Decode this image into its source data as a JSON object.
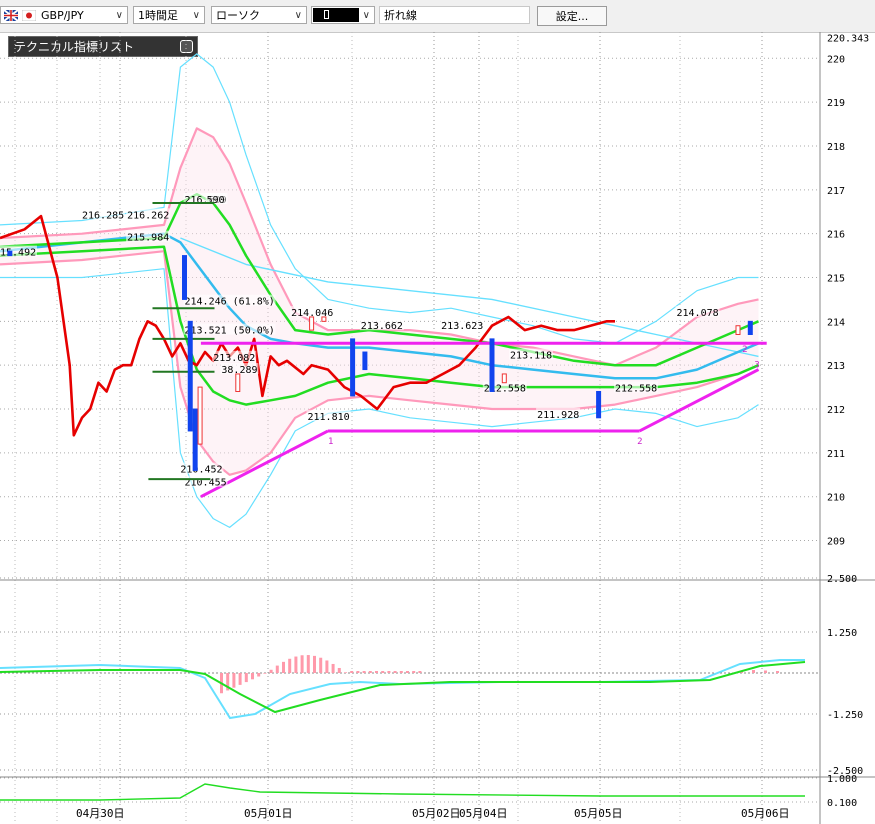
{
  "toolbar": {
    "symbol": "GBP/JPY",
    "timeframe": "1時間足",
    "chart_type": "ローソク",
    "line_type": "折れ線",
    "settings_label": "設定..."
  },
  "indicator_list": {
    "title": "テクニカル指標リスト"
  },
  "colors": {
    "close_line": "#e60000",
    "bollinger_outer": "#66e0ff",
    "bollinger_inner": "#ff99bb",
    "ma_green": "#22dd22",
    "ma_blue": "#33bbee",
    "trendline": "#ee22ee",
    "candle_up": "#ee3333",
    "candle_down": "#1144ee"
  },
  "chart_data": {
    "type": "line",
    "price_axis": {
      "ticks": [
        "220.343",
        "220",
        "219",
        "218",
        "217",
        "216",
        "215",
        "214",
        "213",
        "212",
        "211",
        "210",
        "209"
      ],
      "current_price": "220.343",
      "ylim": [
        208.1,
        220.6
      ]
    },
    "macd_axis": {
      "ticks": [
        "2.500",
        "1.250",
        "-1.250",
        "-2.500"
      ]
    },
    "osc_axis": {
      "ticks": [
        "1.000",
        "0.100"
      ]
    },
    "date_labels": [
      "04月30日",
      "05月01日",
      "05月02日",
      "05月04日",
      "05月05日",
      "05月06日"
    ],
    "annotations": [
      {
        "text": "216.285",
        "x": 0.1,
        "y": 216.35
      },
      {
        "text": "216.262",
        "x": 0.155,
        "y": 216.35
      },
      {
        "text": "215.984",
        "x": 0.155,
        "y": 215.84
      },
      {
        "text": "15.492",
        "x": 0.0,
        "y": 215.5
      },
      {
        "text": "216.609",
        "x": 0.225,
        "y": 216.7
      },
      {
        "text": "590",
        "x": 0.252,
        "y": 216.7
      },
      {
        "text": "214.246 (61.8%)",
        "x": 0.225,
        "y": 214.38
      },
      {
        "text": "213.521 (50.0%)",
        "x": 0.225,
        "y": 213.72
      },
      {
        "text": "213.082",
        "x": 0.26,
        "y": 213.1
      },
      {
        "text": "38.289",
        "x": 0.27,
        "y": 212.82
      },
      {
        "text": "214.046",
        "x": 0.355,
        "y": 214.12
      },
      {
        "text": "211.810",
        "x": 0.375,
        "y": 211.75
      },
      {
        "text": "213.662",
        "x": 0.44,
        "y": 213.82
      },
      {
        "text": "213.623",
        "x": 0.538,
        "y": 213.82
      },
      {
        "text": "213.118",
        "x": 0.622,
        "y": 213.15
      },
      {
        "text": "212.558",
        "x": 0.59,
        "y": 212.4
      },
      {
        "text": "211.928",
        "x": 0.655,
        "y": 211.8
      },
      {
        "text": "212.558",
        "x": 0.75,
        "y": 212.4
      },
      {
        "text": "214.078",
        "x": 0.825,
        "y": 214.12
      },
      {
        "text": "210.452",
        "x": 0.22,
        "y": 210.55
      },
      {
        "text": "210.455",
        "x": 0.225,
        "y": 210.25
      }
    ],
    "series": [
      {
        "name": "close",
        "x": [
          0,
          0.03,
          0.05,
          0.07,
          0.085,
          0.09,
          0.1,
          0.11,
          0.12,
          0.13,
          0.14,
          0.15,
          0.16,
          0.17,
          0.18,
          0.19,
          0.2,
          0.21,
          0.22,
          0.23,
          0.24,
          0.25,
          0.26,
          0.27,
          0.28,
          0.29,
          0.3,
          0.31,
          0.32,
          0.33,
          0.34,
          0.35,
          0.37,
          0.38,
          0.4,
          0.42,
          0.44,
          0.46,
          0.48,
          0.5,
          0.52,
          0.54,
          0.56,
          0.58,
          0.6,
          0.62,
          0.64,
          0.66,
          0.68,
          0.7,
          0.72,
          0.74,
          0.75
        ],
        "values": [
          215.9,
          216.1,
          216.4,
          215.0,
          213.0,
          211.4,
          211.8,
          212.0,
          212.6,
          212.4,
          212.9,
          213.0,
          213.0,
          213.6,
          214.0,
          213.9,
          213.6,
          213.2,
          213.5,
          213.1,
          213.0,
          213.3,
          213.1,
          213.5,
          213.2,
          213.4,
          213.0,
          213.6,
          212.3,
          213.2,
          213.0,
          213.1,
          212.8,
          213.0,
          212.9,
          212.5,
          212.3,
          212.0,
          212.5,
          212.6,
          212.6,
          212.8,
          213.0,
          213.4,
          213.9,
          214.1,
          213.8,
          213.9,
          213.8,
          213.8,
          213.9,
          214.0,
          214.0
        ]
      },
      {
        "name": "bb_upper2",
        "x": [
          0,
          0.1,
          0.2,
          0.22,
          0.24,
          0.26,
          0.28,
          0.3,
          0.33,
          0.36,
          0.4,
          0.45,
          0.5,
          0.55,
          0.6,
          0.65,
          0.7,
          0.75,
          0.8,
          0.85,
          0.9,
          0.925
        ],
        "values": [
          216.2,
          216.3,
          216.6,
          219.8,
          220.1,
          219.8,
          219.0,
          217.8,
          216.2,
          215.2,
          214.5,
          214.3,
          214.2,
          214.3,
          214.1,
          213.9,
          213.6,
          213.5,
          214.0,
          214.7,
          215.0,
          215.0
        ]
      },
      {
        "name": "bb_lower2",
        "x": [
          0,
          0.1,
          0.2,
          0.22,
          0.24,
          0.26,
          0.28,
          0.3,
          0.33,
          0.36,
          0.4,
          0.45,
          0.5,
          0.55,
          0.6,
          0.65,
          0.7,
          0.75,
          0.8,
          0.85,
          0.9,
          0.925
        ],
        "values": [
          215.0,
          215.0,
          215.2,
          211.0,
          210.0,
          209.5,
          209.3,
          209.6,
          210.5,
          211.5,
          211.9,
          212.0,
          211.8,
          211.7,
          211.6,
          211.7,
          211.8,
          212.0,
          211.9,
          211.6,
          211.8,
          212.1
        ]
      },
      {
        "name": "bb_upper1",
        "x": [
          0,
          0.1,
          0.2,
          0.22,
          0.24,
          0.26,
          0.28,
          0.3,
          0.33,
          0.36,
          0.4,
          0.45,
          0.5,
          0.55,
          0.6,
          0.65,
          0.7,
          0.75,
          0.8,
          0.85,
          0.9,
          0.925
        ],
        "values": [
          215.9,
          216.0,
          216.2,
          217.5,
          218.4,
          218.2,
          217.6,
          216.7,
          215.3,
          214.2,
          213.8,
          213.8,
          213.8,
          213.7,
          213.5,
          213.4,
          213.2,
          213.0,
          213.4,
          214.1,
          214.4,
          214.5
        ]
      },
      {
        "name": "bb_lower1",
        "x": [
          0,
          0.1,
          0.2,
          0.22,
          0.24,
          0.26,
          0.28,
          0.3,
          0.33,
          0.36,
          0.4,
          0.45,
          0.5,
          0.55,
          0.6,
          0.65,
          0.7,
          0.75,
          0.8,
          0.85,
          0.9,
          0.925
        ],
        "values": [
          215.3,
          215.4,
          215.6,
          212.5,
          211.3,
          210.8,
          210.5,
          210.6,
          211.0,
          211.8,
          212.2,
          212.3,
          212.2,
          212.1,
          212.0,
          212.0,
          212.0,
          212.1,
          212.3,
          212.5,
          212.8,
          213.0
        ]
      },
      {
        "name": "ma_green_upper",
        "x": [
          0,
          0.1,
          0.2,
          0.22,
          0.24,
          0.26,
          0.28,
          0.3,
          0.33,
          0.36,
          0.4,
          0.45,
          0.5,
          0.55,
          0.6,
          0.65,
          0.7,
          0.75,
          0.8,
          0.85,
          0.9,
          0.925
        ],
        "values": [
          215.7,
          215.8,
          215.9,
          216.7,
          216.9,
          216.7,
          216.2,
          215.5,
          214.6,
          213.8,
          213.7,
          213.8,
          213.7,
          213.6,
          213.5,
          213.3,
          213.1,
          213.0,
          213.0,
          213.4,
          213.8,
          214.0
        ]
      },
      {
        "name": "ma_green_lower",
        "x": [
          0,
          0.1,
          0.2,
          0.22,
          0.24,
          0.26,
          0.28,
          0.3,
          0.33,
          0.36,
          0.4,
          0.45,
          0.5,
          0.55,
          0.6,
          0.65,
          0.7,
          0.75,
          0.8,
          0.85,
          0.9,
          0.925
        ],
        "values": [
          215.5,
          215.6,
          215.7,
          214.0,
          212.9,
          212.4,
          212.2,
          212.1,
          212.2,
          212.3,
          212.6,
          212.8,
          212.7,
          212.6,
          212.5,
          212.5,
          212.5,
          212.5,
          212.5,
          212.6,
          212.8,
          213.0
        ]
      },
      {
        "name": "ma_blue",
        "x": [
          0,
          0.1,
          0.2,
          0.22,
          0.24,
          0.26,
          0.28,
          0.3,
          0.33,
          0.36,
          0.4,
          0.45,
          0.5,
          0.55,
          0.6,
          0.65,
          0.7,
          0.75,
          0.8,
          0.85,
          0.9,
          0.925
        ],
        "values": [
          215.6,
          215.8,
          216.0,
          215.8,
          215.3,
          214.8,
          214.3,
          213.9,
          213.6,
          213.5,
          213.4,
          213.4,
          213.3,
          213.2,
          213.0,
          212.9,
          212.8,
          212.7,
          212.7,
          212.9,
          213.3,
          213.5
        ]
      },
      {
        "name": "ma_cyan_slow",
        "x": [
          0.22,
          0.3,
          0.4,
          0.5,
          0.6,
          0.7,
          0.8,
          0.9,
          0.925
        ],
        "values": [
          215.9,
          215.3,
          214.9,
          214.7,
          214.5,
          214.1,
          213.7,
          213.3,
          213.2
        ]
      }
    ],
    "trendlines": [
      {
        "x": [
          0.245,
          0.935
        ],
        "values": [
          213.5,
          213.5
        ]
      },
      {
        "x": [
          0.245,
          0.4
        ],
        "values": [
          210.0,
          211.5
        ]
      },
      {
        "x": [
          0.4,
          0.78
        ],
        "values": [
          211.5,
          211.5
        ]
      },
      {
        "x": [
          0.78,
          0.925
        ],
        "values": [
          211.5,
          212.9
        ]
      }
    ],
    "trend_labels": [
      {
        "text": "1",
        "x": 0.4,
        "y": 211.2
      },
      {
        "text": "2",
        "x": 0.777,
        "y": 211.2
      },
      {
        "text": "2",
        "x": 0.905,
        "y": 213.3
      },
      {
        "text": "3",
        "x": 0.92,
        "y": 212.95
      }
    ]
  }
}
